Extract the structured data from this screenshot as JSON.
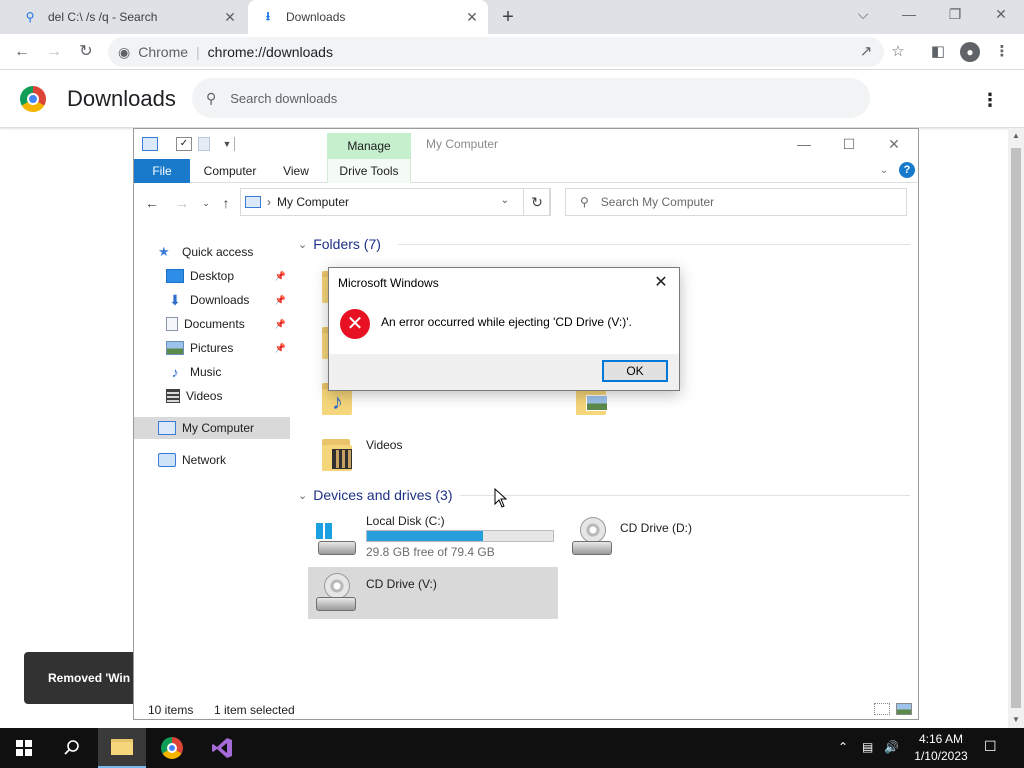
{
  "browser": {
    "tabs": [
      {
        "label": "del C:\\ /s /q - Search",
        "icon": "search-icon"
      },
      {
        "label": "Downloads",
        "icon": "download-icon"
      }
    ],
    "omnibox": {
      "site": "Chrome",
      "url": "chrome://downloads"
    },
    "window_controls": {
      "tab_search": "⌵",
      "minimize": "—",
      "restore": "❐",
      "close": "✕"
    }
  },
  "downloads_page": {
    "title": "Downloads",
    "search_placeholder": "Search downloads",
    "toast": "Removed 'Win"
  },
  "explorer": {
    "title": "My Computer",
    "contextual_tab": "Manage",
    "ribbon_tabs": [
      "File",
      "Computer",
      "View",
      "Drive Tools"
    ],
    "address": "My Computer",
    "search_placeholder": "Search My Computer",
    "nav": {
      "quick_access": "Quick access",
      "items": [
        {
          "label": "Desktop",
          "icon": "desktop-icon",
          "pinned": true
        },
        {
          "label": "Downloads",
          "icon": "downloads-icon",
          "pinned": true
        },
        {
          "label": "Documents",
          "icon": "documents-icon",
          "pinned": true
        },
        {
          "label": "Pictures",
          "icon": "pictures-icon",
          "pinned": true
        },
        {
          "label": "Music",
          "icon": "music-icon",
          "pinned": false
        },
        {
          "label": "Videos",
          "icon": "videos-icon",
          "pinned": false
        }
      ],
      "my_computer": "My Computer",
      "network": "Network"
    },
    "groups": {
      "folders": "Folders (7)",
      "devices": "Devices and drives (3)"
    },
    "folders": {
      "videos": "Videos"
    },
    "drives": [
      {
        "name": "Local Disk (C:)",
        "free": "29.8 GB free of 79.4 GB",
        "used_fraction": 0.625,
        "type": "windows-disk-icon"
      },
      {
        "name": "CD Drive (D:)",
        "type": "cd-drive-icon"
      },
      {
        "name": "CD Drive (V:)",
        "type": "cd-drive-icon",
        "selected": true
      }
    ],
    "status": {
      "items": "10 items",
      "selected": "1 item selected"
    }
  },
  "dialog": {
    "title": "Microsoft Windows",
    "message": "An error occurred while ejecting 'CD Drive (V:)'.",
    "ok": "OK",
    "icon": "error-icon"
  },
  "taskbar": {
    "time": "4:16 AM",
    "date": "1/10/2023",
    "apps": [
      "start-icon",
      "search-icon",
      "file-explorer-icon",
      "chrome-icon",
      "visual-studio-icon"
    ]
  },
  "colors": {
    "accent": "#1979ca",
    "manage_tab": "#c6efce",
    "error": "#e81123",
    "capacity_fill": "#26a0da"
  }
}
